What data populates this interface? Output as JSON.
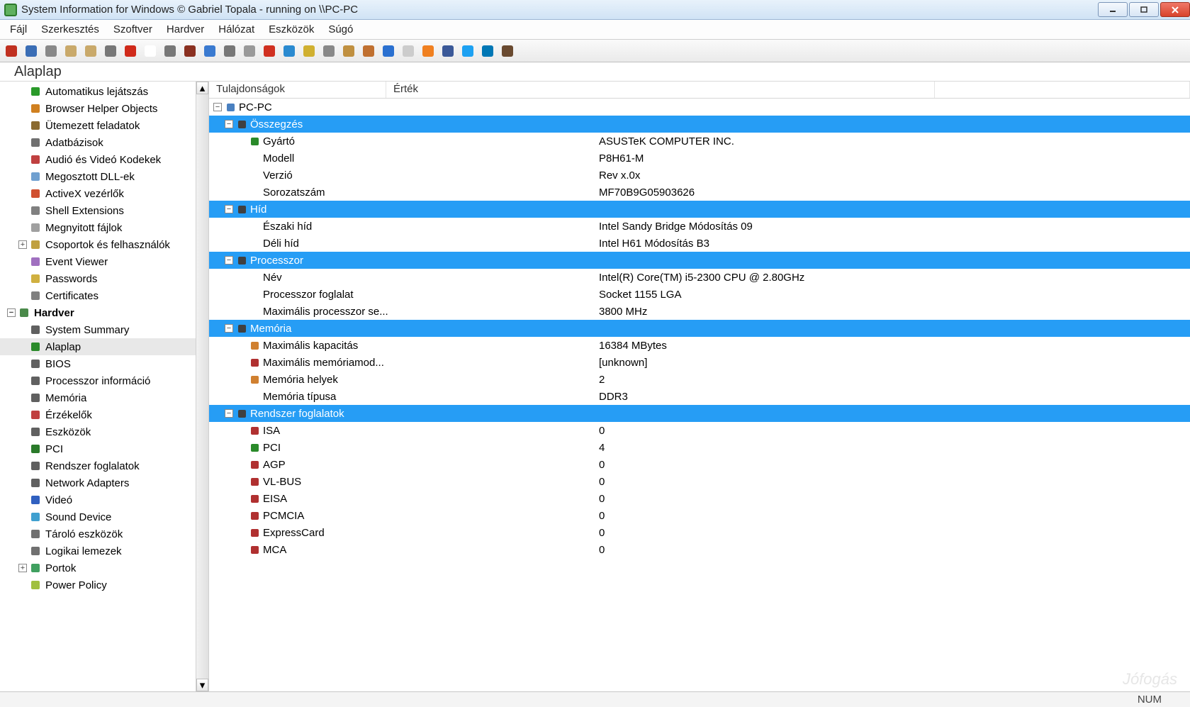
{
  "window": {
    "title": "System Information for Windows   © Gabriel Topala - running on \\\\PC-PC"
  },
  "menu": [
    "Fájl",
    "Szerkesztés",
    "Szoftver",
    "Hardver",
    "Hálózat",
    "Eszközök",
    "Súgó"
  ],
  "toolbar_icons": [
    "exit",
    "save",
    "cut",
    "copy",
    "paste",
    "print",
    "stop",
    "page",
    "gauge",
    "level",
    "network",
    "list",
    "timer",
    "record",
    "refresh",
    "key",
    "tools",
    "group",
    "home",
    "help",
    "mail",
    "rss",
    "facebook",
    "twitter",
    "linkedin",
    "coffee"
  ],
  "header": "Alaplap",
  "sidebar": {
    "items": [
      {
        "label": "Automatikus lejátszás",
        "indent": 42,
        "icon": "play-icon",
        "color": "#2a9a2a"
      },
      {
        "label": "Browser Helper Objects",
        "indent": 42,
        "icon": "globe-icon",
        "color": "#d08020"
      },
      {
        "label": "Ütemezett feladatok",
        "indent": 42,
        "icon": "schedule-icon",
        "color": "#8a6a30"
      },
      {
        "label": "Adatbázisok",
        "indent": 42,
        "icon": "database-icon",
        "color": "#707070"
      },
      {
        "label": "Audió és Videó Kodekek",
        "indent": 42,
        "icon": "codec-icon",
        "color": "#c04040"
      },
      {
        "label": "Megosztott DLL-ek",
        "indent": 42,
        "icon": "dll-icon",
        "color": "#70a0d0"
      },
      {
        "label": "ActiveX vezérlők",
        "indent": 42,
        "icon": "activex-icon",
        "color": "#d05030"
      },
      {
        "label": "Shell Extensions",
        "indent": 42,
        "icon": "shell-icon",
        "color": "#808080"
      },
      {
        "label": "Megnyitott fájlok",
        "indent": 42,
        "icon": "file-icon",
        "color": "#a0a0a0"
      },
      {
        "label": "Csoportok és felhasználók",
        "indent": 26,
        "icon": "users-icon",
        "color": "#c0a040",
        "exp": "+"
      },
      {
        "label": "Event Viewer",
        "indent": 42,
        "icon": "event-icon",
        "color": "#a070c0"
      },
      {
        "label": "Passwords",
        "indent": 42,
        "icon": "key-icon",
        "color": "#d0b040"
      },
      {
        "label": "Certificates",
        "indent": 42,
        "icon": "cert-icon",
        "color": "#808080"
      },
      {
        "label": "Hardver",
        "indent": 10,
        "icon": "hardware-icon",
        "color": "#4a8a4a",
        "bold": true,
        "exp": "-"
      },
      {
        "label": "System Summary",
        "indent": 42,
        "icon": "summary-icon",
        "color": "#606060"
      },
      {
        "label": "Alaplap",
        "indent": 42,
        "icon": "mobo-icon",
        "color": "#2a8a2a",
        "selected": true
      },
      {
        "label": "BIOS",
        "indent": 42,
        "icon": "bios-icon",
        "color": "#606060"
      },
      {
        "label": "Processzor információ",
        "indent": 42,
        "icon": "cpu-icon",
        "color": "#606060"
      },
      {
        "label": "Memória",
        "indent": 42,
        "icon": "memory-icon",
        "color": "#606060"
      },
      {
        "label": "Érzékelők",
        "indent": 42,
        "icon": "sensor-icon",
        "color": "#c04040"
      },
      {
        "label": "Eszközök",
        "indent": 42,
        "icon": "devices-icon",
        "color": "#606060"
      },
      {
        "label": "PCI",
        "indent": 42,
        "icon": "pci-icon",
        "color": "#2a7a2a"
      },
      {
        "label": "Rendszer foglalatok",
        "indent": 42,
        "icon": "slots-icon",
        "color": "#606060"
      },
      {
        "label": "Network Adapters",
        "indent": 42,
        "icon": "nic-icon",
        "color": "#606060"
      },
      {
        "label": "Videó",
        "indent": 42,
        "icon": "video-icon",
        "color": "#3060c0"
      },
      {
        "label": "Sound Device",
        "indent": 42,
        "icon": "sound-icon",
        "color": "#40a0d0"
      },
      {
        "label": "Tároló eszközök",
        "indent": 42,
        "icon": "storage-icon",
        "color": "#707070"
      },
      {
        "label": "Logikai lemezek",
        "indent": 42,
        "icon": "disk-icon",
        "color": "#707070"
      },
      {
        "label": "Portok",
        "indent": 26,
        "icon": "ports-icon",
        "color": "#40a060",
        "exp": "+"
      },
      {
        "label": "Power Policy",
        "indent": 42,
        "icon": "power-icon",
        "color": "#a0c040"
      }
    ]
  },
  "columns": {
    "prop": "Tulajdonságok",
    "val": "Érték"
  },
  "details": {
    "root": "PC-PC",
    "groups": [
      {
        "name": "Összegzés",
        "icon": "summary-icon",
        "rows": [
          {
            "prop": "Gyártó",
            "val": "ASUSTeK COMPUTER INC.",
            "icon": "mobo-icon",
            "ic": "#2a8a2a"
          },
          {
            "prop": "Modell",
            "val": "P8H61-M"
          },
          {
            "prop": "Verzió",
            "val": "Rev x.0x"
          },
          {
            "prop": "Sorozatszám",
            "val": "MF70B9G05903626"
          }
        ]
      },
      {
        "name": "Híd",
        "icon": "bridge-icon",
        "rows": [
          {
            "prop": "Északi híd",
            "val": "Intel Sandy Bridge Módosítás 09"
          },
          {
            "prop": "Déli híd",
            "val": "Intel H61 Módosítás B3"
          }
        ]
      },
      {
        "name": "Processzor",
        "icon": "cpu-icon",
        "rows": [
          {
            "prop": "Név",
            "val": "Intel(R) Core(TM) i5-2300 CPU @ 2.80GHz"
          },
          {
            "prop": "Processzor foglalat",
            "val": "Socket 1155 LGA"
          },
          {
            "prop": "Maximális processzor se...",
            "val": "3800 MHz"
          }
        ]
      },
      {
        "name": "Memória",
        "icon": "memory-icon",
        "rows": [
          {
            "prop": "Maximális kapacitás",
            "val": "16384 MBytes",
            "icon": "shield-icon",
            "ic": "#d08030"
          },
          {
            "prop": "Maximális memóriamod...",
            "val": "[unknown]",
            "icon": "shield-icon",
            "ic": "#b03030"
          },
          {
            "prop": "Memória helyek",
            "val": "2",
            "icon": "shield-icon",
            "ic": "#d08030"
          },
          {
            "prop": "Memória típusa",
            "val": "DDR3"
          }
        ]
      },
      {
        "name": "Rendszer foglalatok",
        "icon": "slots-icon",
        "rows": [
          {
            "prop": "ISA",
            "val": "0",
            "icon": "shield-icon",
            "ic": "#b03030"
          },
          {
            "prop": "PCI",
            "val": "4",
            "icon": "shield-icon",
            "ic": "#2a8a2a"
          },
          {
            "prop": "AGP",
            "val": "0",
            "icon": "shield-icon",
            "ic": "#b03030"
          },
          {
            "prop": "VL-BUS",
            "val": "0",
            "icon": "shield-icon",
            "ic": "#b03030"
          },
          {
            "prop": "EISA",
            "val": "0",
            "icon": "shield-icon",
            "ic": "#b03030"
          },
          {
            "prop": "PCMCIA",
            "val": "0",
            "icon": "shield-icon",
            "ic": "#b03030"
          },
          {
            "prop": "ExpressCard",
            "val": "0",
            "icon": "shield-icon",
            "ic": "#b03030"
          },
          {
            "prop": "MCA",
            "val": "0",
            "icon": "shield-icon",
            "ic": "#b03030"
          }
        ]
      }
    ]
  },
  "status": {
    "num": "NUM"
  },
  "watermark": "Jófogás"
}
